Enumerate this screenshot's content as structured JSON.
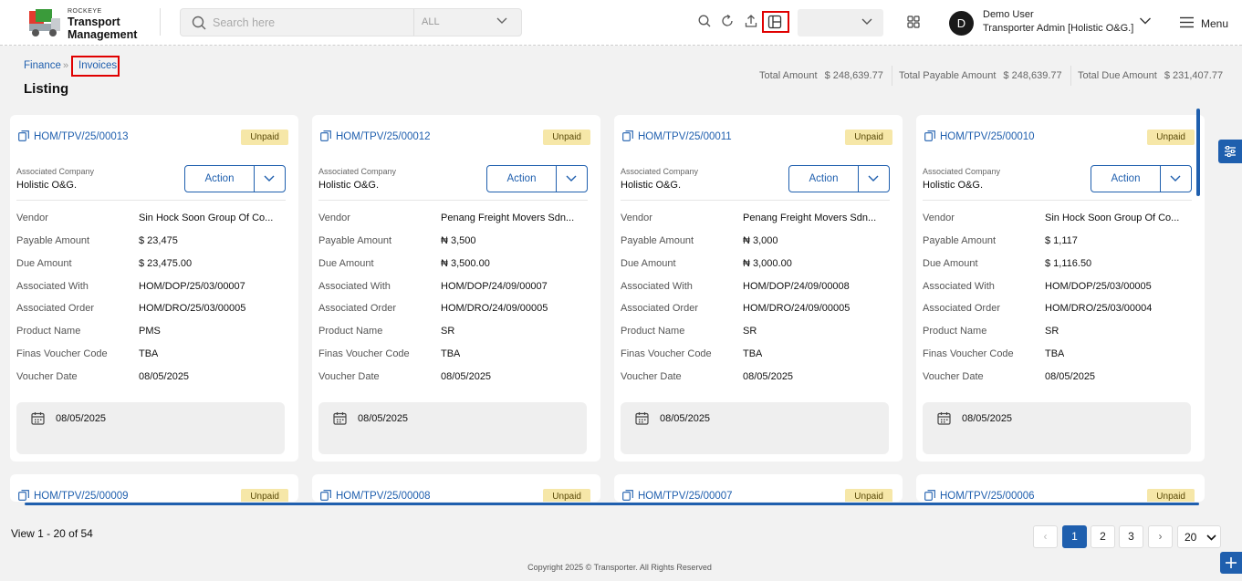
{
  "app": {
    "brand_top": "ROCKEYE",
    "brand_line1": "Transport",
    "brand_line2": "Management"
  },
  "search": {
    "placeholder": "Search here",
    "scope": "ALL"
  },
  "user": {
    "initial": "D",
    "name": "Demo User",
    "role": "Transporter Admin [Holistic O&G.]"
  },
  "menu_label": "Menu",
  "breadcrumb": {
    "parent": "Finance",
    "current": "Invoices"
  },
  "page_title": "Listing",
  "summary": {
    "total_label": "Total Amount",
    "total_value": "$ 248,639.77",
    "payable_label": "Total Payable Amount",
    "payable_value": "$ 248,639.77",
    "due_label": "Total Due Amount",
    "due_value": "$ 231,407.77"
  },
  "field_labels": {
    "associated_company": "Associated Company",
    "action": "Action",
    "vendor": "Vendor",
    "payable_amount": "Payable Amount",
    "due_amount": "Due Amount",
    "associated_with": "Associated With",
    "associated_order": "Associated Order",
    "product_name": "Product Name",
    "voucher_code": "Finas Voucher Code",
    "voucher_date": "Voucher Date"
  },
  "invoices": [
    {
      "id": "HOM/TPV/25/00013",
      "status": "Unpaid",
      "company": "Holistic O&G.",
      "vendor": "Sin Hock Soon Group Of Co...",
      "payable": "$ 23,475",
      "due": "$ 23,475.00",
      "associated_with": "HOM/DOP/25/03/00007",
      "associated_order": "HOM/DRO/25/03/00005",
      "product": "PMS",
      "voucher_code": "TBA",
      "voucher_date": "08/05/2025",
      "date": "08/05/2025"
    },
    {
      "id": "HOM/TPV/25/00012",
      "status": "Unpaid",
      "company": "Holistic O&G.",
      "vendor": "Penang Freight Movers Sdn...",
      "payable": "₦ 3,500",
      "due": "₦ 3,500.00",
      "associated_with": "HOM/DOP/24/09/00007",
      "associated_order": "HOM/DRO/24/09/00005",
      "product": "SR",
      "voucher_code": "TBA",
      "voucher_date": "08/05/2025",
      "date": "08/05/2025"
    },
    {
      "id": "HOM/TPV/25/00011",
      "status": "Unpaid",
      "company": "Holistic O&G.",
      "vendor": "Penang Freight Movers Sdn...",
      "payable": "₦ 3,000",
      "due": "₦ 3,000.00",
      "associated_with": "HOM/DOP/24/09/00008",
      "associated_order": "HOM/DRO/24/09/00005",
      "product": "SR",
      "voucher_code": "TBA",
      "voucher_date": "08/05/2025",
      "date": "08/05/2025"
    },
    {
      "id": "HOM/TPV/25/00010",
      "status": "Unpaid",
      "company": "Holistic O&G.",
      "vendor": "Sin Hock Soon Group Of Co...",
      "payable": "$ 1,117",
      "due": "$ 1,116.50",
      "associated_with": "HOM/DOP/25/03/00005",
      "associated_order": "HOM/DRO/25/03/00004",
      "product": "SR",
      "voucher_code": "TBA",
      "voucher_date": "08/05/2025",
      "date": "08/05/2025"
    }
  ],
  "invoices_row2": [
    {
      "id": "HOM/TPV/25/00009",
      "status": "Unpaid"
    },
    {
      "id": "HOM/TPV/25/00008",
      "status": "Unpaid"
    },
    {
      "id": "HOM/TPV/25/00007",
      "status": "Unpaid"
    },
    {
      "id": "HOM/TPV/25/00006",
      "status": "Unpaid"
    }
  ],
  "pagination": {
    "view_text": "View 1 - 20 of 54",
    "pages": [
      "1",
      "2",
      "3"
    ],
    "per_page": "20"
  },
  "footer": {
    "copyright": "Copyright 2025 © Transporter. All Rights Reserved"
  },
  "colors": {
    "accent": "#1f5fae",
    "badge": "#f6e7a8",
    "highlight": "#e00000"
  }
}
